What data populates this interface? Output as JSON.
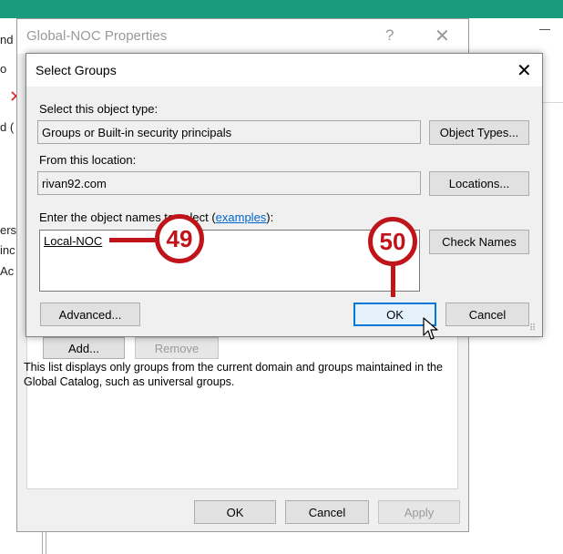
{
  "background_window": {
    "left_fragments": [
      "nd",
      "o",
      "d (",
      "ers",
      "inc",
      "Ac"
    ],
    "minimize_glyph": "—"
  },
  "properties_dialog": {
    "title": "Global-NOC Properties",
    "help_glyph": "?",
    "close_glyph": "✕",
    "add_label": "Add...",
    "remove_label": "Remove",
    "info_text": "This list displays only groups from the current domain and groups maintained in the Global Catalog, such as universal groups.",
    "ok_label": "OK",
    "cancel_label": "Cancel",
    "apply_label": "Apply"
  },
  "select_groups_dialog": {
    "title": "Select Groups",
    "close_glyph": "✕",
    "object_type_label": "Select this object type:",
    "object_type_value": "Groups or Built-in security principals",
    "object_types_button": "Object Types...",
    "location_label": "From this location:",
    "location_value": "rivan92.com",
    "locations_button": "Locations...",
    "names_label_prefix": "Enter the object names to select (",
    "names_label_link": "examples",
    "names_label_suffix": "):",
    "names_value": "Local-NOC",
    "check_names_button": "Check Names",
    "advanced_button": "Advanced...",
    "ok_button": "OK",
    "cancel_button": "Cancel"
  },
  "annotations": {
    "step_49": "49",
    "step_50": "50",
    "color": "#c0141b"
  },
  "colors": {
    "titlebar_accent": "#1b9b7b",
    "focus_blue": "#0078d7",
    "link": "#0066cc"
  }
}
